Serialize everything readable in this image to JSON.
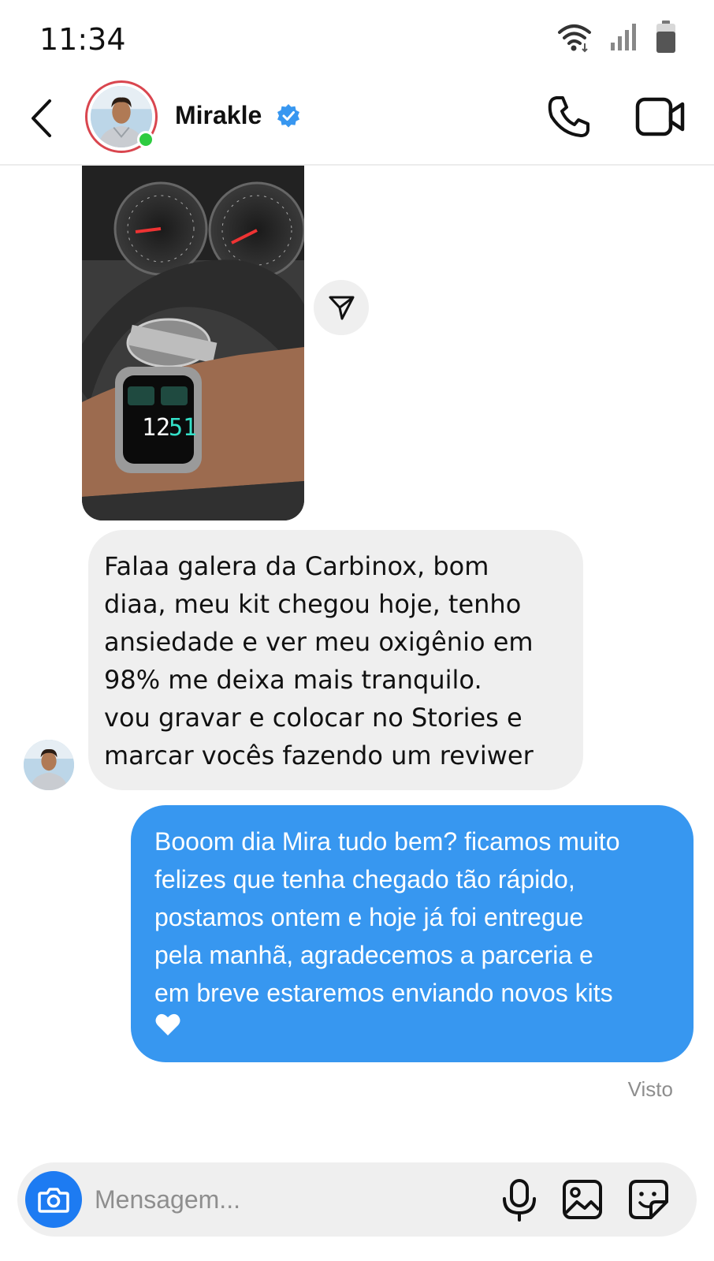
{
  "status_bar": {
    "time": "11:34",
    "icons": [
      "wifi-icon",
      "cellular-signal-icon",
      "battery-icon"
    ]
  },
  "header": {
    "back_icon": "chevron-left-icon",
    "contact_name": "Mirakle",
    "verified_icon": "verified-badge-icon",
    "online": true,
    "actions": [
      "phone-call-icon",
      "video-call-icon"
    ]
  },
  "messages": {
    "photo": {
      "description_icon": "photo-message",
      "share_icon": "send-paper-plane-icon"
    },
    "incoming": {
      "text": "Falaa galera da Carbinox, bom\ndiaa, meu kit chegou hoje, tenho\nansiedade e ver meu oxigênio em\n98% me deixa mais tranquilo.\nvou gravar e colocar no Stories e\nmarcar vocês fazendo um reviwer"
    },
    "outgoing": {
      "text": "Booom dia Mira tudo bem? ficamos muito\nfelizes que tenha chegado tão rápido,\npostamos ontem e hoje já foi entregue\npela manhã, agradecemos a parceria e\nem breve estaremos enviando novos kits",
      "trailing_icon": "heart-icon"
    },
    "seen_label": "Visto"
  },
  "composer": {
    "placeholder": "Mensagem...",
    "value": "",
    "icons": [
      "camera-icon",
      "microphone-icon",
      "gallery-icon",
      "sticker-icon"
    ]
  },
  "colors": {
    "accent_blue": "#3797f0",
    "camera_blue": "#1d7bf2",
    "bubble_gray": "#efefef",
    "online_green": "#2ecc40",
    "verified_blue": "#3897f0",
    "story_ring": "#d9464f"
  }
}
